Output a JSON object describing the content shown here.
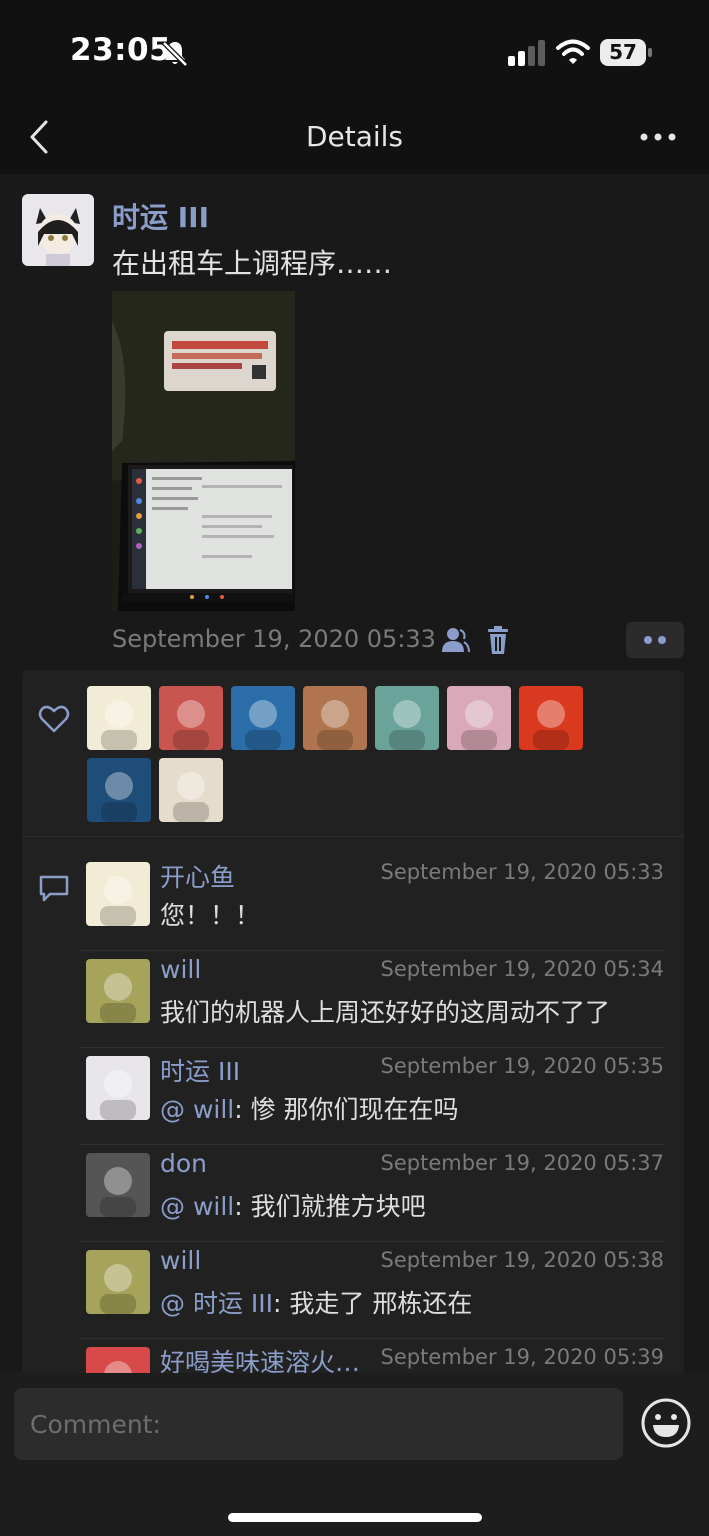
{
  "status_bar": {
    "time": "23:05",
    "battery": "57",
    "icons": [
      "bell-slash-icon",
      "cellular-signal-icon",
      "wifi-icon",
      "battery-icon"
    ]
  },
  "nav": {
    "title": "Details",
    "back_icon": "chevron-left-icon",
    "more_icon": "ellipsis-icon"
  },
  "post": {
    "author": "时运 III",
    "text": "在出租车上调程序……",
    "timestamp": "September 19, 2020 05:33",
    "photo_description": "photo-thumbnail",
    "icons": [
      "people-icon",
      "trash-icon",
      "more-actions-icon"
    ]
  },
  "likes": {
    "icon": "heart-icon",
    "avatars": [
      {
        "name": "liker-avatar-1",
        "color": "#f2ecd6"
      },
      {
        "name": "liker-avatar-2",
        "color": "#c8554f"
      },
      {
        "name": "liker-avatar-3",
        "color": "#2b6da8"
      },
      {
        "name": "liker-avatar-4",
        "color": "#b0744f"
      },
      {
        "name": "liker-avatar-5",
        "color": "#6aa39a"
      },
      {
        "name": "liker-avatar-6",
        "color": "#d8a9b8"
      },
      {
        "name": "liker-avatar-7",
        "color": "#d9391f"
      },
      {
        "name": "liker-avatar-8",
        "color": "#1f4d7a"
      },
      {
        "name": "liker-avatar-9",
        "color": "#e5dccb"
      }
    ]
  },
  "comments": {
    "icon": "comment-icon",
    "items": [
      {
        "author": "开心鱼",
        "time": "September 19, 2020 05:33",
        "mention": "",
        "text": "您！！！",
        "avatar_color": "#f2ecd6"
      },
      {
        "author": "will",
        "time": "September 19, 2020 05:34",
        "mention": "",
        "text": "我们的机器人上周还好好的这周动不了了",
        "avatar_color": "#a6a35a"
      },
      {
        "author": "时运 III",
        "time": "September 19, 2020 05:35",
        "mention": "@ will",
        "text": ": 惨 那你们现在在吗",
        "avatar_color": "#e8e6ea"
      },
      {
        "author": "don",
        "time": "September 19, 2020 05:37",
        "mention": "@ will",
        "text": ": 我们就推方块吧",
        "avatar_color": "#555555"
      },
      {
        "author": "will",
        "time": "September 19, 2020 05:38",
        "mention": "@ 时运 III",
        "text": ": 我走了 邢栋还在",
        "avatar_color": "#a6a35a"
      },
      {
        "author": "好喝美味速溶火…",
        "time": "September 19, 2020 05:39",
        "mention": "",
        "text": "",
        "avatar_color": "#d84a4a"
      }
    ]
  },
  "input": {
    "placeholder": "Comment:",
    "emoji_icon": "emoji-icon"
  }
}
